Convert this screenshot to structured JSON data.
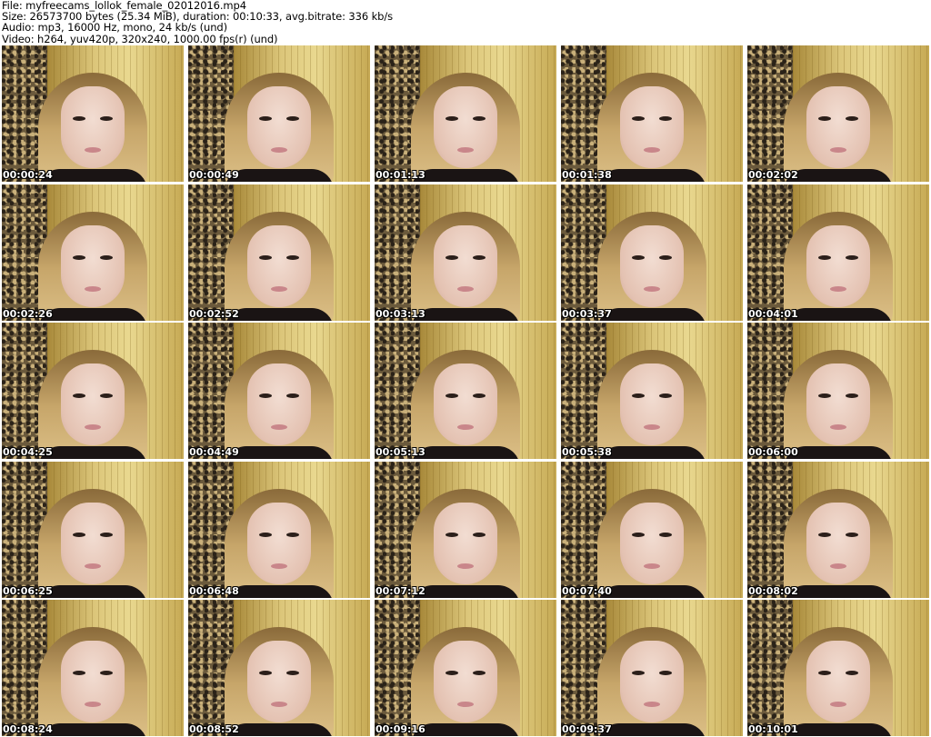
{
  "header": {
    "line_file": "File: myfreecams_lollok_female_02012016.mp4",
    "line_size": "Size: 26573700 bytes (25.34 MiB), duration: 00:10:33, avg.bitrate: 336 kb/s",
    "line_audio": "Audio: mp3, 16000 Hz, mono, 24 kb/s (und)",
    "line_video": "Video: h264, yuv420p, 320x240, 1000.00 fps(r) (und)"
  },
  "thumbnails": [
    "00:00:24",
    "00:00:49",
    "00:01:13",
    "00:01:38",
    "00:02:02",
    "00:02:26",
    "00:02:52",
    "00:03:13",
    "00:03:37",
    "00:04:01",
    "00:04:25",
    "00:04:49",
    "00:05:13",
    "00:05:38",
    "00:06:00",
    "00:06:25",
    "00:06:48",
    "00:07:12",
    "00:07:40",
    "00:08:02",
    "00:08:24",
    "00:08:52",
    "00:09:16",
    "00:09:37",
    "00:10:01"
  ]
}
